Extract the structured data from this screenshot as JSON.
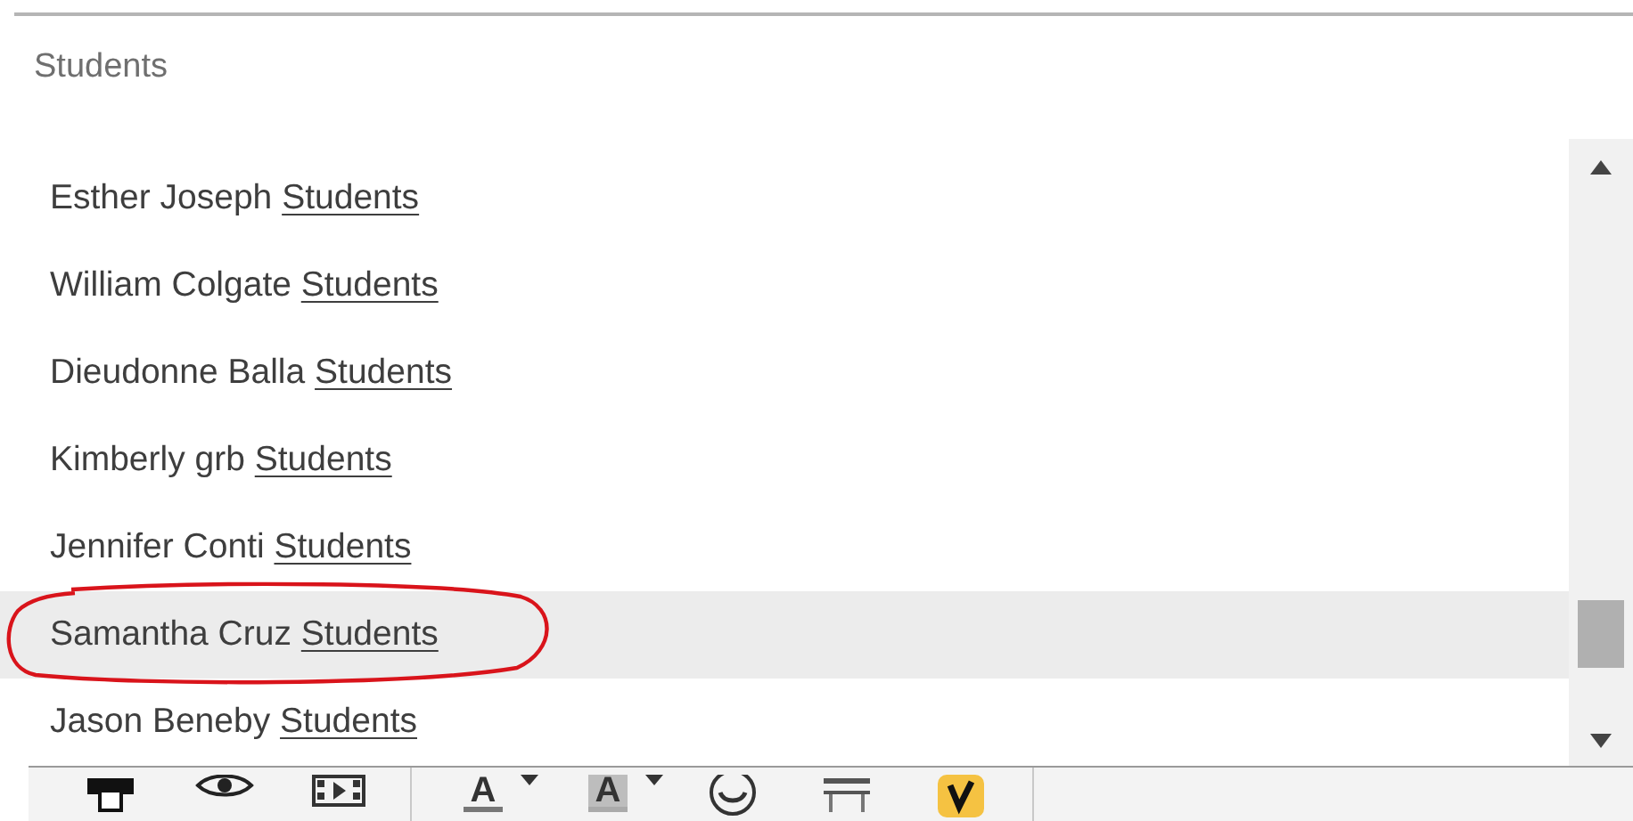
{
  "search": {
    "value": "Students"
  },
  "results": [
    {
      "name": "Esther Joseph",
      "group": "Students",
      "selected": false,
      "circled": false
    },
    {
      "name": "William Colgate",
      "group": "Students",
      "selected": false,
      "circled": false
    },
    {
      "name": "Dieudonne Balla",
      "group": "Students",
      "selected": false,
      "circled": false
    },
    {
      "name": "Kimberly grb",
      "group": "Students",
      "selected": false,
      "circled": false
    },
    {
      "name": "Jennifer Conti",
      "group": "Students",
      "selected": false,
      "circled": false
    },
    {
      "name": "Samantha Cruz",
      "group": "Students",
      "selected": true,
      "circled": true
    },
    {
      "name": "Jason Beneby",
      "group": "Students",
      "selected": false,
      "circled": false
    }
  ],
  "toolbar": [
    {
      "kind": "print"
    },
    {
      "kind": "preview"
    },
    {
      "kind": "media"
    },
    {
      "kind": "separator"
    },
    {
      "kind": "text-color",
      "glyph": "A"
    },
    {
      "kind": "caret"
    },
    {
      "kind": "highlight-color",
      "glyph": "A"
    },
    {
      "kind": "caret"
    },
    {
      "kind": "smiley"
    },
    {
      "kind": "table"
    },
    {
      "kind": "check"
    },
    {
      "kind": "separator"
    }
  ]
}
